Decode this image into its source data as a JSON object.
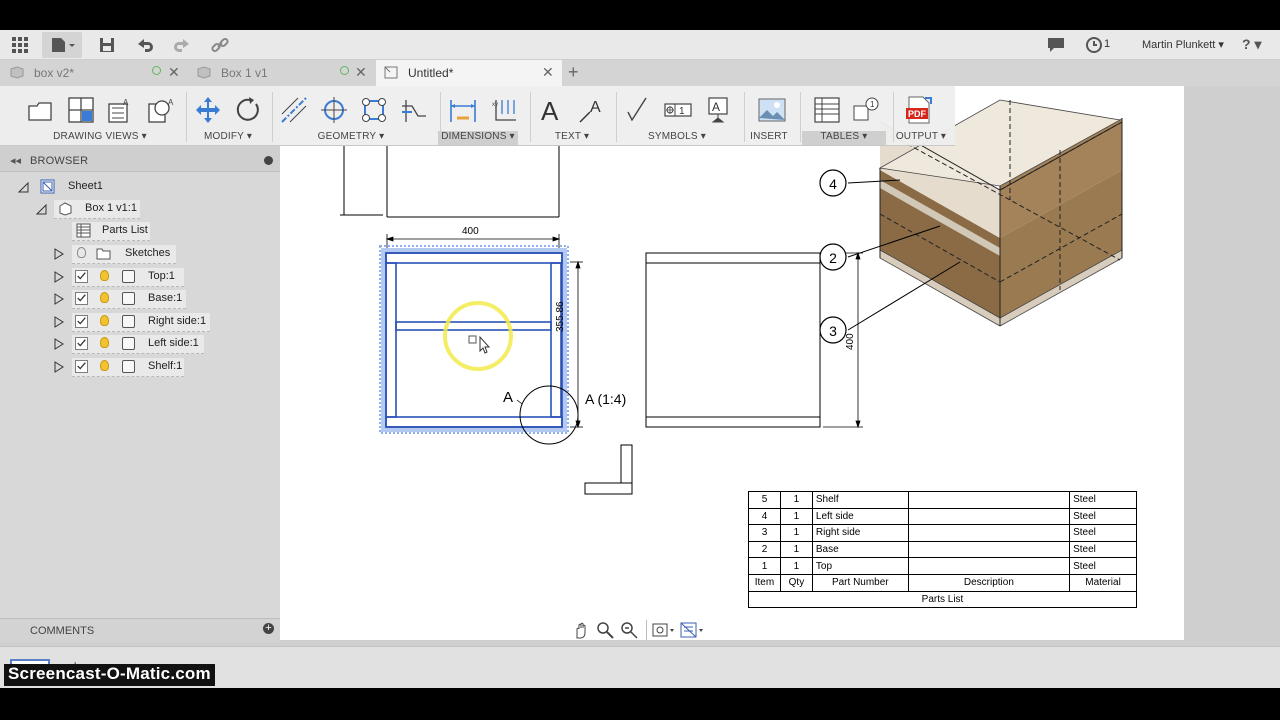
{
  "appbar": {
    "job_count": "1",
    "user_name": "Martin Plunkett ▾",
    "help_label": "? ▾"
  },
  "tabs": [
    {
      "label": "box v2*",
      "close": "✕"
    },
    {
      "label": "Box 1 v1",
      "close": "✕"
    },
    {
      "label": "Untitled*",
      "close": "✕"
    }
  ],
  "new_tab": "+",
  "toolbar": {
    "groups": [
      "DRAWING VIEWS ▾",
      "MODIFY ▾",
      "GEOMETRY ▾",
      "DIMENSIONS ▾",
      "TEXT ▾",
      "SYMBOLS ▾",
      "INSERT",
      "TABLES ▾",
      "OUTPUT ▾"
    ],
    "pdf_label": "PDF"
  },
  "browser": {
    "title": "BROWSER",
    "items": [
      "Sheet1",
      "Box 1 v1:1",
      "Parts List",
      "Sketches",
      "Top:1",
      "Base:1",
      "Right side:1",
      "Left side:1",
      "Shelf:1"
    ]
  },
  "comments": {
    "title": "COMMENTS",
    "add": "+"
  },
  "drawing": {
    "dim_400_top": "400",
    "dim_355": "355.86",
    "dim_400_side": "400",
    "detail_marker": "A",
    "detail_label": "A (1:4)",
    "balloons": [
      "4",
      "2",
      "3"
    ]
  },
  "parts_list": {
    "rows": [
      {
        "item": "5",
        "qty": "1",
        "part": "Shelf",
        "desc": "",
        "material": "Steel"
      },
      {
        "item": "4",
        "qty": "1",
        "part": "Left side",
        "desc": "",
        "material": "Steel"
      },
      {
        "item": "3",
        "qty": "1",
        "part": "Right side",
        "desc": "",
        "material": "Steel"
      },
      {
        "item": "2",
        "qty": "1",
        "part": "Base",
        "desc": "",
        "material": "Steel"
      },
      {
        "item": "1",
        "qty": "1",
        "part": "Top",
        "desc": "",
        "material": "Steel"
      }
    ],
    "headers": {
      "item": "Item",
      "qty": "Qty",
      "part": "Part Number",
      "desc": "Description",
      "material": "Material"
    },
    "title": "Parts List"
  },
  "watermark": "Screencast-O-Matic.com",
  "colors": {
    "selection": "#3b6fd1",
    "highlight_circle": "#f0e63a",
    "wood": "#8a6b45"
  }
}
